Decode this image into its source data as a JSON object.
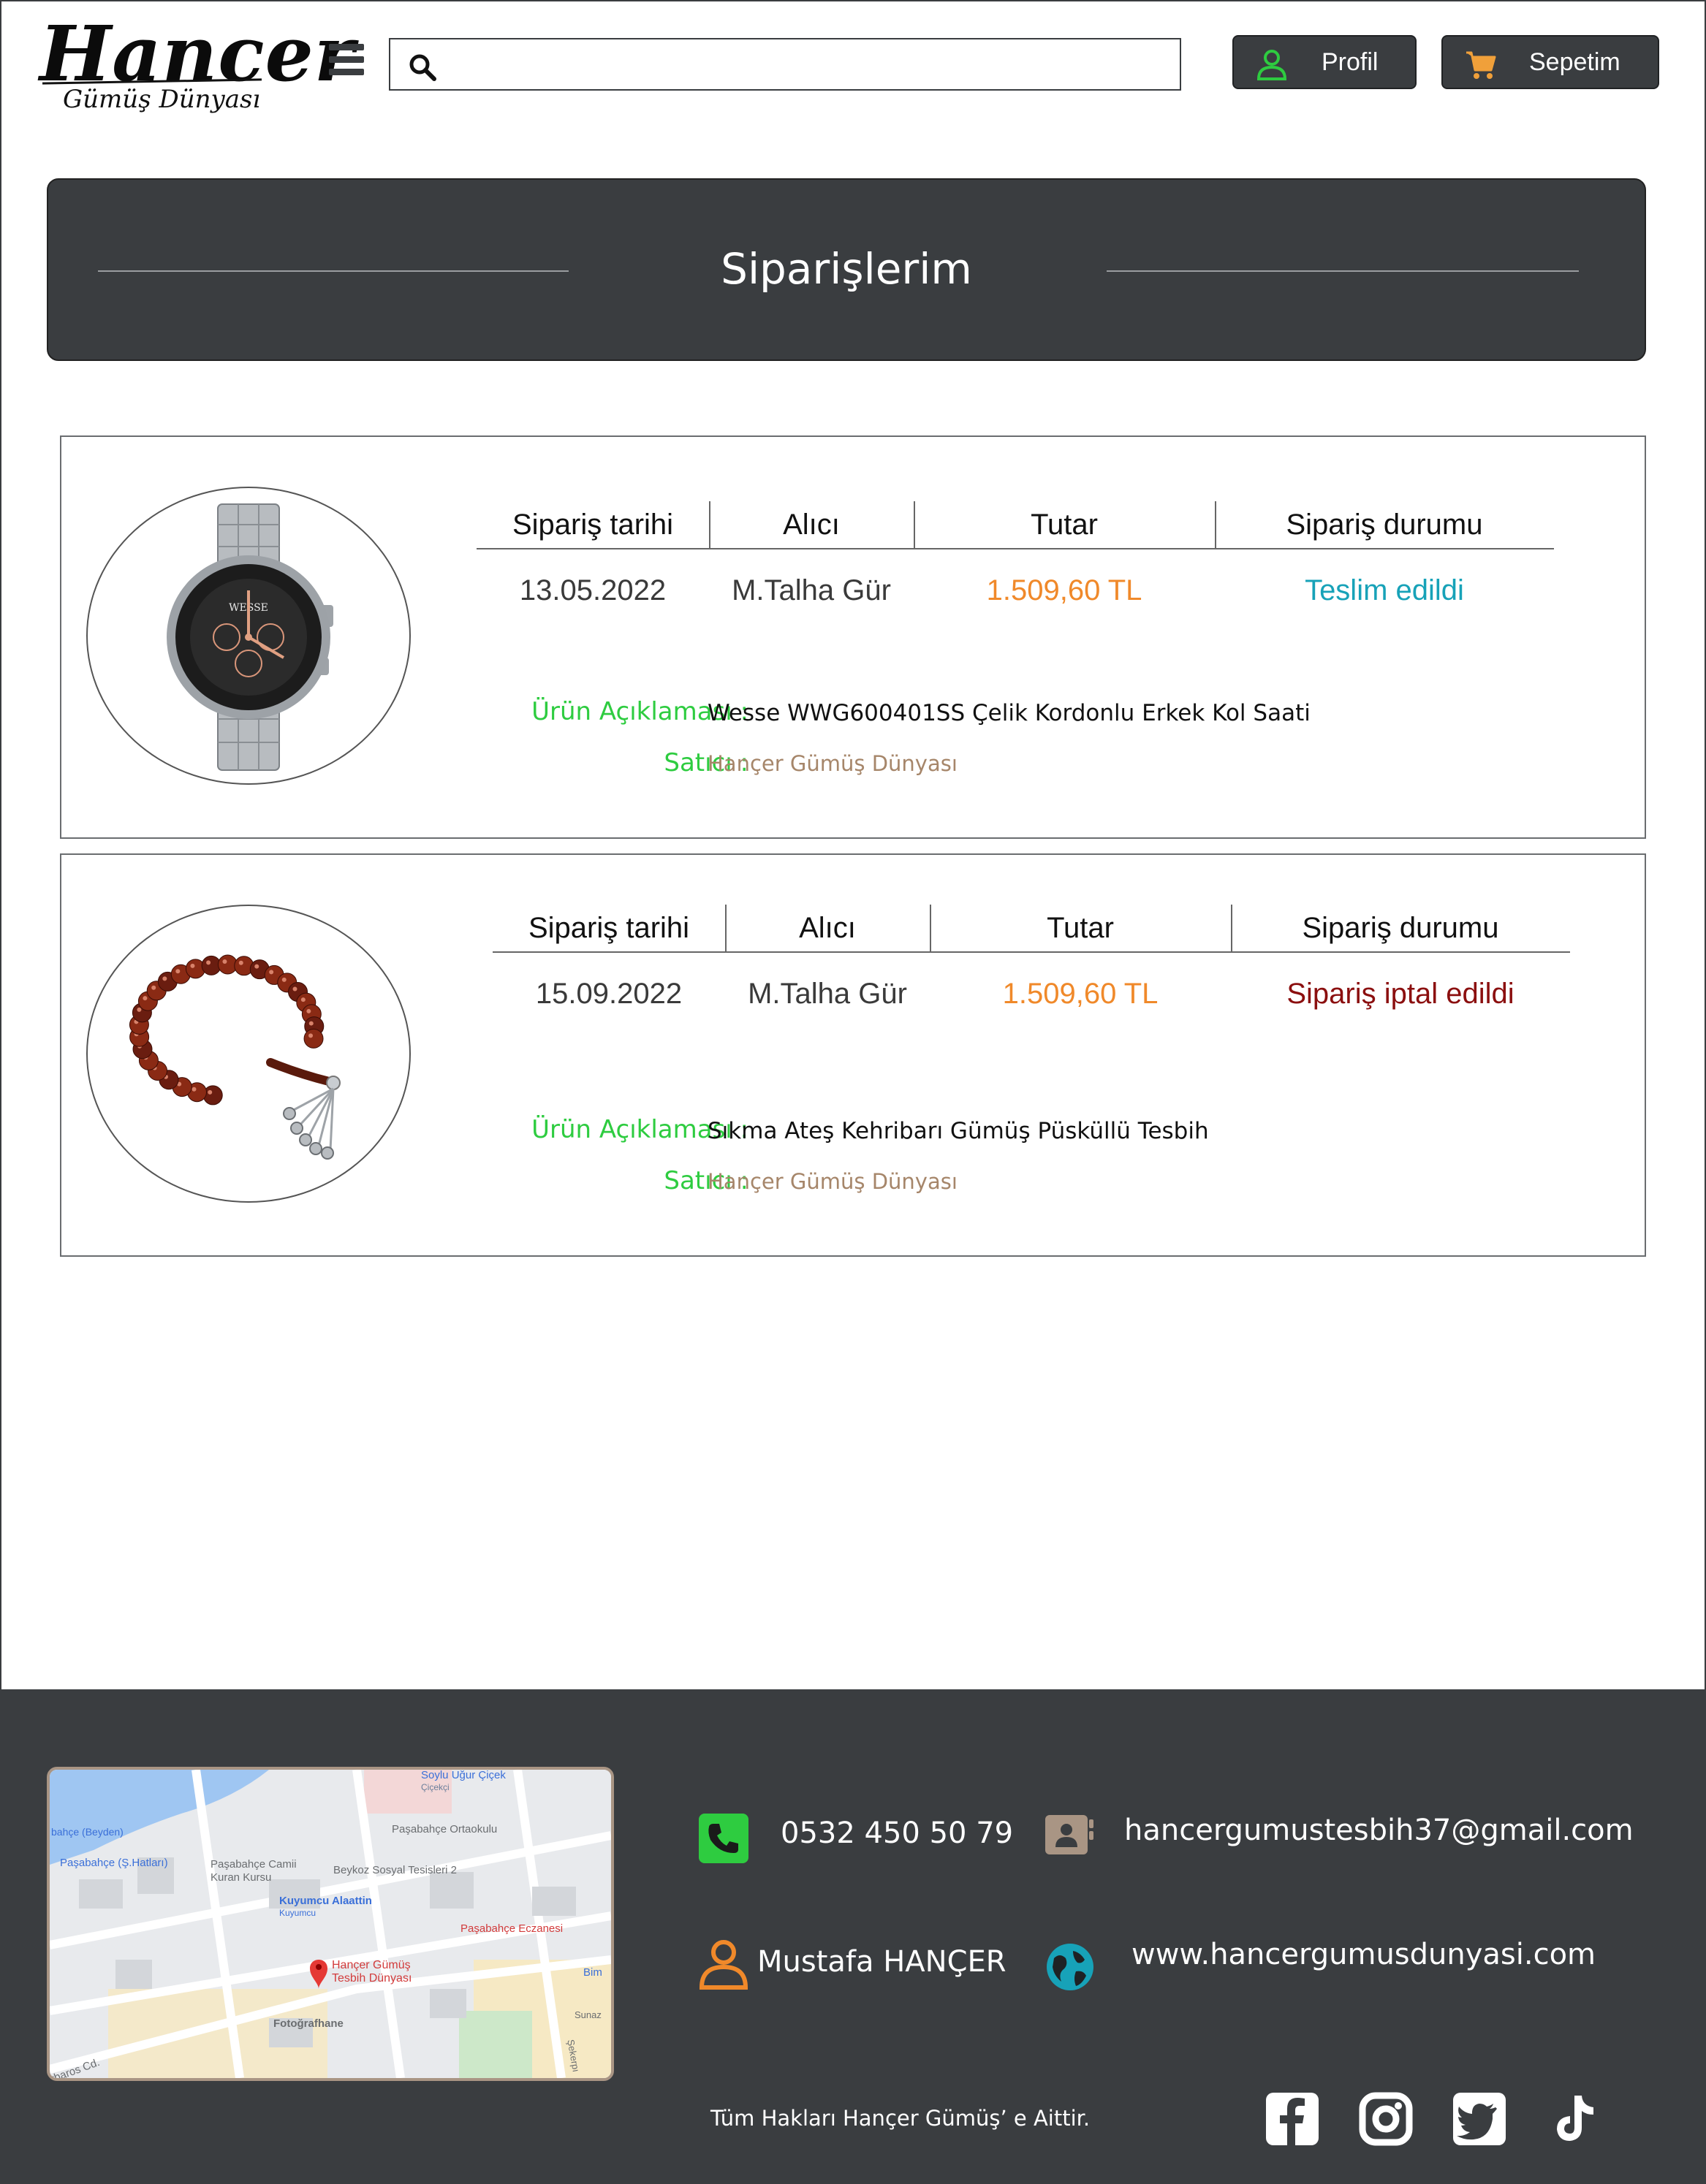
{
  "header": {
    "logo_main": "Hancer",
    "logo_sub": "Gümüş Dünyası",
    "search_placeholder": "",
    "profile_label": "Profil",
    "cart_label": "Sepetim"
  },
  "page": {
    "title": "Siparişlerim"
  },
  "table_headers": {
    "date": "Sipariş tarihi",
    "recipient": "Alıcı",
    "amount": "Tutar",
    "status": "Sipariş durumu"
  },
  "labels": {
    "description": "Ürün Açıklaması :",
    "seller": "Satıcı :"
  },
  "orders": [
    {
      "date": "13.05.2022",
      "recipient": "M.Talha Gür",
      "amount": "1.509,60 TL",
      "status": "Teslim edildi",
      "description": "Wesse WWG600401SS Çelik Kordonlu Erkek Kol Saati",
      "seller": "Hançer Gümüş Dünyası",
      "image_icon": "wristwatch-image",
      "watch_brand": "WESSE"
    },
    {
      "date": "15.09.2022",
      "recipient": "M.Talha Gür",
      "amount": "1.509,60 TL",
      "status": "Sipariş iptal edildi",
      "description": "Sıkma Ateş Kehribarı Gümüş Püsküllü Tesbih",
      "seller": "Hançer Gümüş Dünyası",
      "image_icon": "prayer-beads-image"
    }
  ],
  "colors": {
    "dark": "#3a3d40",
    "amount": "#f0892a",
    "status_delivered": "#17a2b8",
    "status_cancelled": "#8b0f0f",
    "label_green": "#2ecc40",
    "seller_brown": "#a6866a"
  },
  "footer": {
    "phone": "0532 450 50 79",
    "email": "hancergumustesbih37@gmail.com",
    "name": "Mustafa HANÇER",
    "website": "www.hancergumusdunyasi.com",
    "copyright": "Tüm Hakları Hançer Gümüş’ e Aittir.",
    "map": {
      "pin_label_1": "Hançer Gümüş",
      "pin_label_2": "Tesbih Dünyası",
      "places": [
        "Soylu Uğur Çiçek",
        "Çiçekçi",
        "Paşabahçe Ortaokulu",
        "bahçe (Beyden)",
        "Paşabahçe (Ş.Hatları)",
        "Paşabahçe Camii",
        "Kuran Kursu",
        "Beykoz Sosyal Tesisleri 2",
        "Kuyumcu Alaattin",
        "Kuyumcu",
        "Paşabahçe Eczanesi",
        "Bim",
        "Fotoğrafhane",
        "Sunaz",
        "rbaros Cd.",
        "Şekerpı"
      ]
    },
    "social": [
      "facebook-icon",
      "instagram-icon",
      "twitter-icon",
      "tiktok-icon"
    ]
  }
}
